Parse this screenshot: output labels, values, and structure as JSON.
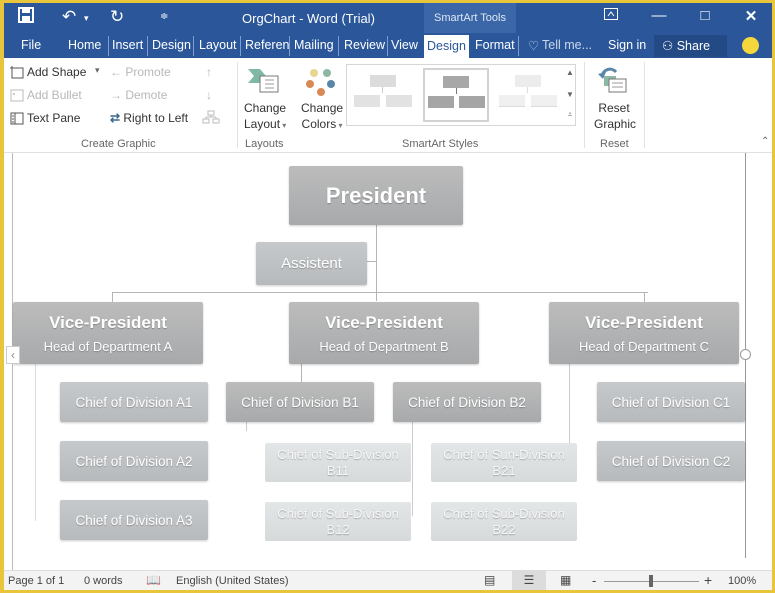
{
  "window": {
    "title": "OrgChart - Word (Trial)",
    "contextual_tab_group": "SmartArt Tools",
    "controls": {
      "ribbon_display": "ribbon-display-icon",
      "minimize": "—",
      "maximize": "□",
      "close": "✕"
    }
  },
  "quick_access": {
    "save": "save-icon",
    "undo": "undo-icon",
    "redo": "redo-icon",
    "customize": "customize-icon"
  },
  "tabs": [
    {
      "label": "File"
    },
    {
      "label": "Home"
    },
    {
      "label": "Insert"
    },
    {
      "label": "Design"
    },
    {
      "label": "Layout"
    },
    {
      "label": "Referen"
    },
    {
      "label": "Mailing"
    },
    {
      "label": "Review"
    },
    {
      "label": "View"
    },
    {
      "label": "Design",
      "active": true
    },
    {
      "label": "Format"
    }
  ],
  "tell_me": "Tell me...",
  "sign_in": "Sign in",
  "share": "Share",
  "ribbon": {
    "create_graphic": {
      "label": "Create Graphic",
      "add_shape": "Add Shape",
      "add_bullet": "Add Bullet",
      "text_pane": "Text Pane",
      "promote": "Promote",
      "demote": "Demote",
      "right_to_left": "Right to Left"
    },
    "layouts": {
      "label": "Layouts",
      "change_layout_1": "Change",
      "change_layout_2": "Layout"
    },
    "colors": {
      "change_colors_1": "Change",
      "change_colors_2": "Colors"
    },
    "styles": {
      "label": "SmartArt Styles"
    },
    "reset": {
      "label": "Reset",
      "reset_graphic_1": "Reset",
      "reset_graphic_2": "Graphic"
    }
  },
  "orgchart": {
    "president": "President",
    "assistant": "Assistent",
    "vps": [
      {
        "title": "Vice-President",
        "subtitle": "Head of Department A"
      },
      {
        "title": "Vice-President",
        "subtitle": "Head of Department B"
      },
      {
        "title": "Vice-President",
        "subtitle": "Head of Department C"
      }
    ],
    "divisions_a": [
      "Chief of Division A1",
      "Chief of Division A2",
      "Chief of Division A3"
    ],
    "divisions_b": [
      "Chief of Division B1",
      "Chief of Division B2"
    ],
    "subdivisions_b1": [
      {
        "line1": "Chief of Sub-Division",
        "line2": "B11"
      },
      {
        "line1": "Chief of Sub-Division",
        "line2": "B12"
      }
    ],
    "subdivisions_b2": [
      {
        "line1": "Chief of Sun-Division",
        "line2": "B21"
      },
      {
        "line1": "Chief of Sub-Division",
        "line2": "B22"
      }
    ],
    "divisions_c": [
      "Chief of Division C1",
      "Chief of Division C2"
    ]
  },
  "status": {
    "page": "Page 1 of 1",
    "words": "0 words",
    "language": "English (United States)",
    "zoom": "100%",
    "zoom_minus": "-",
    "zoom_plus": "+"
  },
  "colors": {
    "accent": "#2b579a",
    "node_dark": "#a7a9ab",
    "node_light": "#d6dadb"
  }
}
